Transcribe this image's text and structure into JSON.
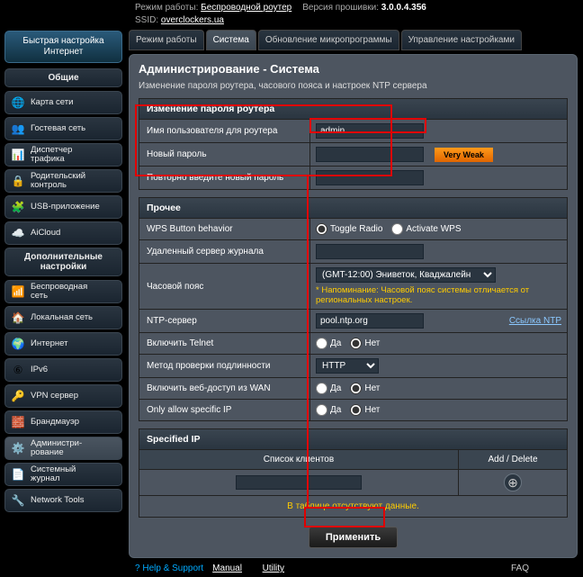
{
  "top": {
    "mode_label": "Режим работы:",
    "mode_value": "Беспроводной роутер",
    "fw_label": "Версия прошивки:",
    "fw_value": "3.0.0.4.356",
    "ssid_label": "SSID:",
    "ssid_value": "overclockers.ua"
  },
  "quick_setup": "Быстрая настройка Интернет",
  "sections": {
    "general": "Общие",
    "advanced": "Дополнительные настройки"
  },
  "menu": {
    "map": "Карта сети",
    "guest": "Гостевая сеть",
    "traffic1": "Диспетчер",
    "traffic2": "трафика",
    "parental1": "Родительский",
    "parental2": "контроль",
    "usb": "USB-приложение",
    "aicloud": "AiCloud",
    "wifi1": "Беспроводная",
    "wifi2": "сеть",
    "lan": "Локальная сеть",
    "wan": "Интернет",
    "ipv6": "IPv6",
    "vpn": "VPN сервер",
    "fw": "Брандмауэр",
    "admin1": "Администри-",
    "admin2": "рование",
    "syslog1": "Системный",
    "syslog2": "журнал",
    "tools": "Network Tools"
  },
  "tabs": {
    "t1": "Режим работы",
    "t2": "Система",
    "t3": "Обновление микропрограммы",
    "t4": "Управление настройками"
  },
  "page": {
    "title": "Администрирование - Система",
    "subtitle": "Изменение пароля роутера, часового пояса и настроек NTP сервера"
  },
  "password_section": "Изменение пароля роутера",
  "fields": {
    "login_label": "Имя пользователя для роутера",
    "login_value": "admin",
    "newpw_label": "Новый пароль",
    "confirm_label": "Повторно введите новый пароль",
    "strength": "Very Weak"
  },
  "other_section": "Прочее",
  "other": {
    "wps_label": "WPS Button behavior",
    "wps_opt1": "Toggle Radio",
    "wps_opt2": "Activate WPS",
    "remote_label": "Удаленный сервер журнала",
    "tz_label": "Часовой пояс",
    "tz_value": "(GMT-12:00) Эниветок, Кваджалейн",
    "tz_hint": "* Напоминание: Часовой пояс системы отличается от региональных настроек.",
    "ntp_label": "NTP-сервер",
    "ntp_value": "pool.ntp.org",
    "ntp_link": "Ссылка NTP",
    "telnet_label": "Включить Telnet",
    "auth_label": "Метод проверки подлинности",
    "auth_value": "HTTP",
    "webwan_label": "Включить веб-доступ из WAN",
    "specip_label": "Only allow specific IP",
    "yes": "Да",
    "no": "Нет"
  },
  "spec": {
    "header": "Specified IP",
    "col1": "Список клиентов",
    "col2": "Add / Delete",
    "empty": "В таблице отсутствуют данные."
  },
  "apply": "Применить",
  "footer": {
    "help": "Help & Support",
    "manual": "Manual",
    "utility": "Utility",
    "faq": "FAQ"
  }
}
